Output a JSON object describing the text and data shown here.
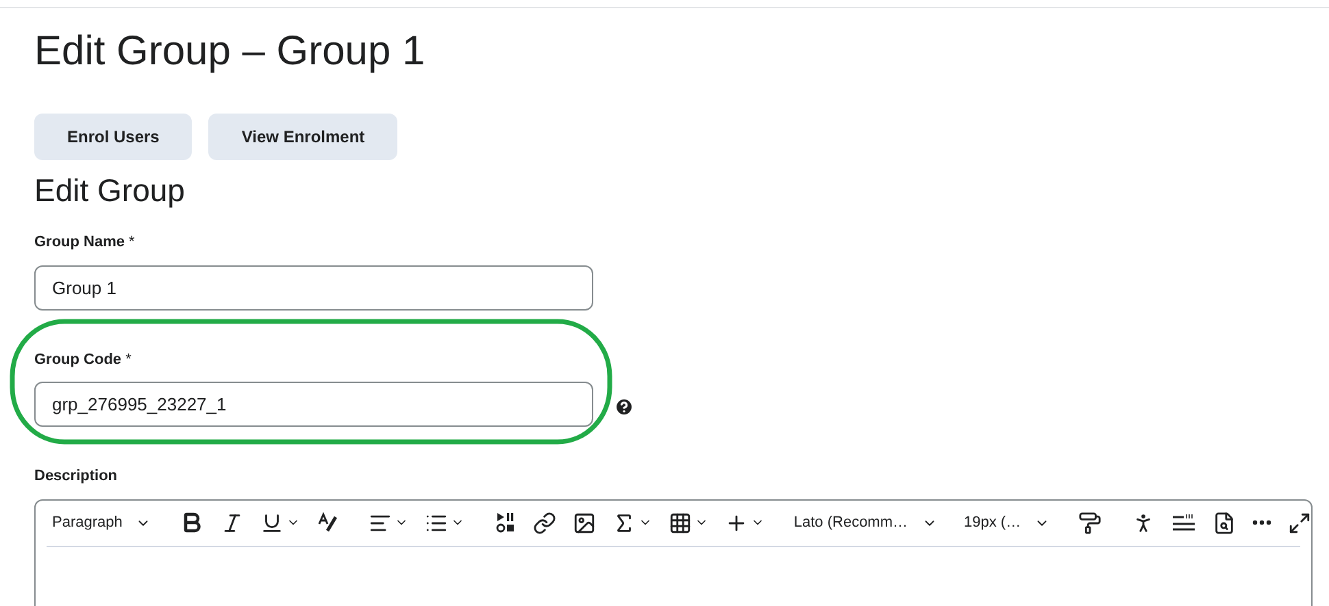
{
  "page_title": "Edit Group – Group 1",
  "buttons": [
    "Enrol Users",
    "View Enrolment"
  ],
  "section_title": "Edit Group",
  "fields": [
    {
      "label": "Group Name",
      "required_mark": "*",
      "value": "Group 1",
      "help": false,
      "highlighted": false
    },
    {
      "label": "Group Code",
      "required_mark": "*",
      "value": "grp_276995_23227_1",
      "help": true,
      "highlighted": true
    }
  ],
  "description": {
    "label": "Description",
    "toolbar": [
      {
        "kind": "select",
        "label": "Paragraph"
      },
      {
        "kind": "separator"
      },
      {
        "kind": "bold",
        "menu": false
      },
      {
        "kind": "italic",
        "menu": false
      },
      {
        "kind": "underline",
        "menu": true
      },
      {
        "kind": "text-color",
        "menu": false
      },
      {
        "kind": "separator"
      },
      {
        "kind": "align",
        "menu": true
      },
      {
        "kind": "list",
        "menu": true
      },
      {
        "kind": "separator"
      },
      {
        "kind": "media",
        "menu": false
      },
      {
        "kind": "link",
        "menu": false
      },
      {
        "kind": "image",
        "menu": false
      },
      {
        "kind": "equation",
        "menu": true
      },
      {
        "kind": "table",
        "menu": true
      },
      {
        "kind": "insert",
        "menu": true
      },
      {
        "kind": "separator"
      },
      {
        "kind": "select",
        "label": "Lato (Recomm…"
      },
      {
        "kind": "separator"
      },
      {
        "kind": "select",
        "label": "19px (…"
      },
      {
        "kind": "separator"
      },
      {
        "kind": "format-painter",
        "menu": false
      },
      {
        "kind": "separator"
      },
      {
        "kind": "accessibility",
        "menu": false
      },
      {
        "kind": "word-count",
        "menu": false
      },
      {
        "kind": "preview",
        "menu": false
      },
      {
        "kind": "more",
        "menu": false
      },
      {
        "kind": "fullscreen",
        "menu": false
      }
    ]
  }
}
